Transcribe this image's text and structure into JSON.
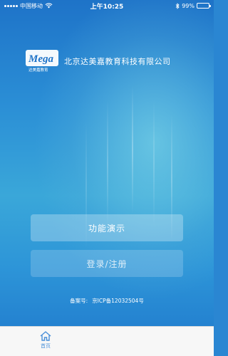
{
  "status_bar": {
    "carrier": "中国移动",
    "time": "上午10:25",
    "battery": "99%",
    "battery_level": 0.99
  },
  "header": {
    "company_name": "北京达美嘉教育科技有限公司",
    "logo_text": "Mega",
    "logo_caption": "达美嘉教育"
  },
  "buttons": {
    "demo_label": "功能演示",
    "login_label": "登录/注册"
  },
  "footer": {
    "icp_label": "备案号:",
    "icp_number": "京ICP备12032504号"
  },
  "tab_bar": {
    "home_label": "首页"
  },
  "colors": {
    "accent": "#4a90d9",
    "background_top": "#1e73c8",
    "background_mid": "#3aa7d9"
  }
}
